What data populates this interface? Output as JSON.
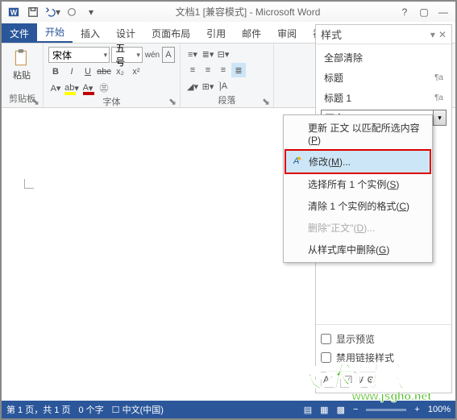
{
  "title": "文档1 [兼容模式] - Microsoft Word",
  "tabs": {
    "file": "文件",
    "home": "开始",
    "insert": "插入",
    "design": "设计",
    "layout": "页面布局",
    "references": "引用",
    "mail": "邮件",
    "review": "审阅",
    "view": "视"
  },
  "clipboard": {
    "paste": "粘贴",
    "label": "剪贴板"
  },
  "font": {
    "name": "宋体",
    "size": "五号",
    "label": "字体",
    "wen": "wén",
    "a": "A"
  },
  "paragraph": {
    "label": "段落"
  },
  "stylesPane": {
    "title": "样式",
    "clear": "全部清除",
    "h1": "标题",
    "h1p": "¶a",
    "t1": "标题 1",
    "t1p": "¶a",
    "body": "正文"
  },
  "ctx": {
    "update": "更新 正文 以匹配所选内容",
    "updateK": "P",
    "modify": "修改",
    "modifyK": "M",
    "selectAll": "选择所有 1 个实例",
    "selectAllK": "S",
    "clearFmt": "清除 1 个实例的格式",
    "clearFmtK": "C",
    "deleteBody": "删除\"正文\"",
    "deleteBodyK": "D",
    "removeFromGallery": "从样式库中删除",
    "removeFromGalleryK": "G"
  },
  "foot": {
    "preview": "显示预览",
    "disableLinked": "禁用链接样式"
  },
  "status": {
    "page": "第 1 页，共 1 页",
    "words": "0 个字",
    "lang": "中文(中国)",
    "zoom": "100%"
  },
  "wm": {
    "txt": "技术员联盟",
    "url": "www.jsgho.net"
  }
}
